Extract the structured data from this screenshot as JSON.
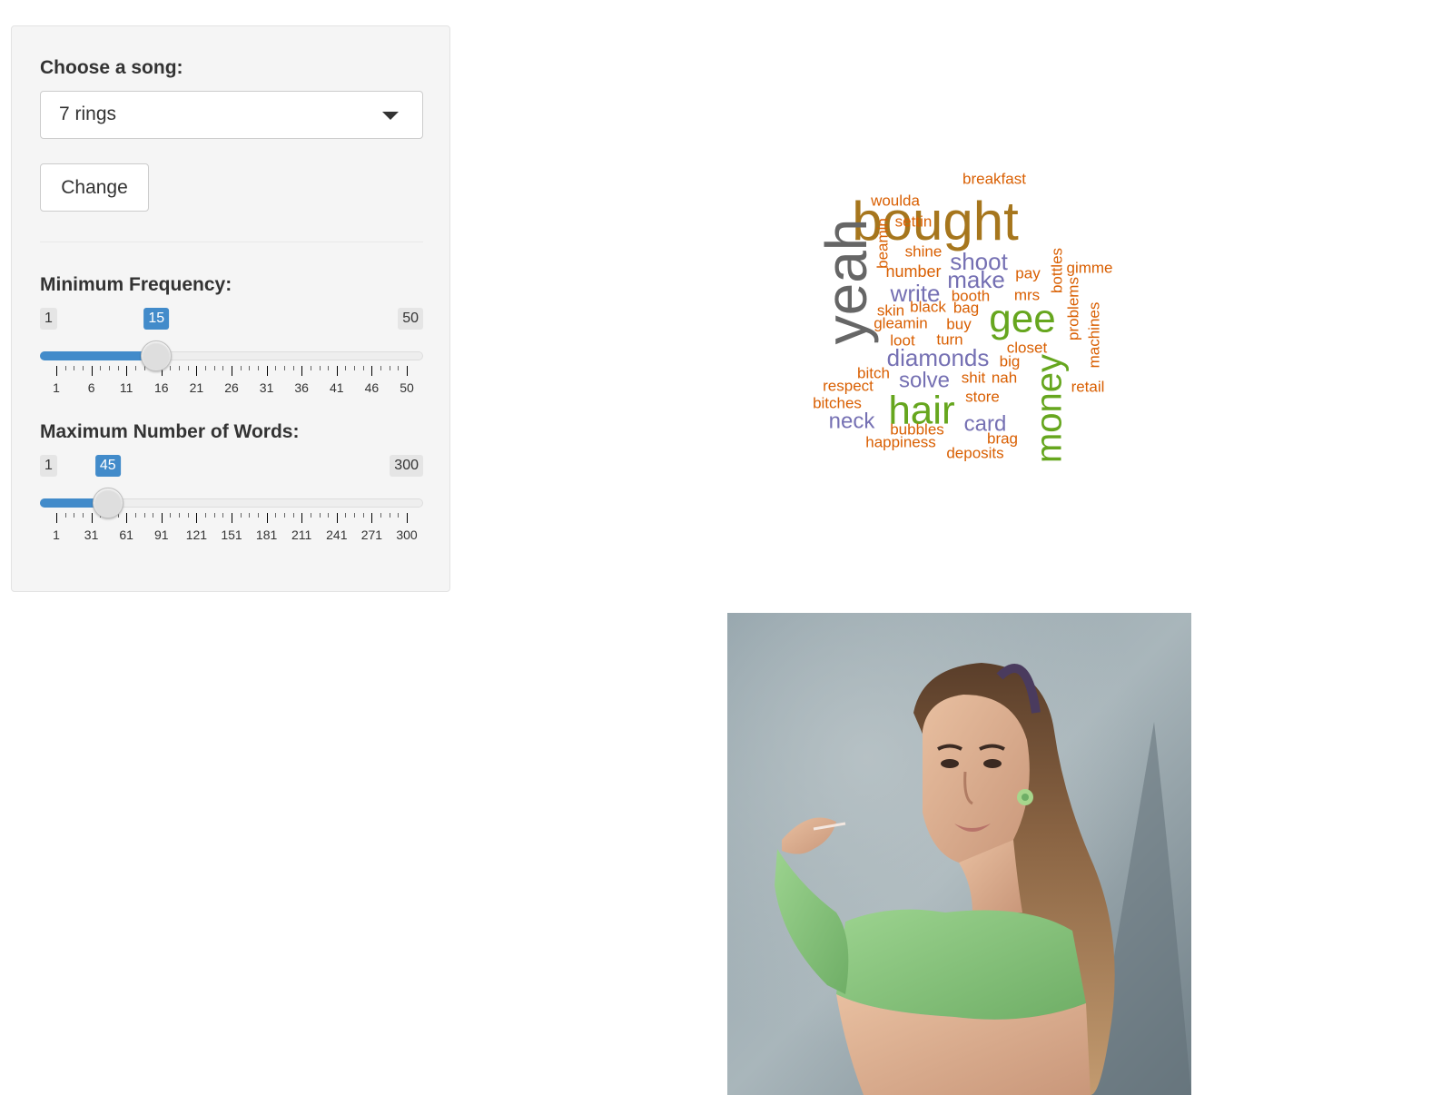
{
  "sidebar": {
    "song_label": "Choose a song:",
    "song_selected": "7 rings",
    "change_button": "Change",
    "min_freq": {
      "label": "Minimum Frequency:",
      "min": 1,
      "max": 50,
      "value": 15,
      "min_text": "1",
      "max_text": "50",
      "value_text": "15",
      "ticks": [
        "1",
        "6",
        "11",
        "16",
        "21",
        "26",
        "31",
        "36",
        "41",
        "46",
        "50"
      ]
    },
    "max_words": {
      "label": "Maximum Number of Words:",
      "min": 1,
      "max": 300,
      "value": 45,
      "min_text": "1",
      "max_text": "300",
      "value_text": "45",
      "ticks": [
        "1",
        "31",
        "61",
        "91",
        "121",
        "151",
        "181",
        "211",
        "241",
        "271",
        "300"
      ]
    }
  },
  "colors": {
    "accent": "#428bca",
    "word_orange": "#d95f02",
    "word_purple": "#7570b3",
    "word_green": "#66a61e",
    "word_gold": "#a6761d",
    "word_gray": "#666666"
  },
  "wordcloud": {
    "words": [
      {
        "text": "bought",
        "color": "#a6761d"
      },
      {
        "text": "yeah",
        "color": "#666666"
      },
      {
        "text": "money",
        "color": "#66a61e"
      },
      {
        "text": "gee",
        "color": "#66a61e"
      },
      {
        "text": "hair",
        "color": "#66a61e"
      },
      {
        "text": "shoot",
        "color": "#7570b3"
      },
      {
        "text": "make",
        "color": "#7570b3"
      },
      {
        "text": "write",
        "color": "#7570b3"
      },
      {
        "text": "diamonds",
        "color": "#7570b3"
      },
      {
        "text": "solve",
        "color": "#7570b3"
      },
      {
        "text": "neck",
        "color": "#7570b3"
      },
      {
        "text": "card",
        "color": "#7570b3"
      },
      {
        "text": "breakfast",
        "color": "#d95f02"
      },
      {
        "text": "woulda",
        "color": "#d95f02"
      },
      {
        "text": "settin",
        "color": "#d95f02"
      },
      {
        "text": "beamin",
        "color": "#d95f02"
      },
      {
        "text": "shine",
        "color": "#d95f02"
      },
      {
        "text": "number",
        "color": "#d95f02"
      },
      {
        "text": "pay",
        "color": "#d95f02"
      },
      {
        "text": "bottles",
        "color": "#d95f02"
      },
      {
        "text": "gimme",
        "color": "#d95f02"
      },
      {
        "text": "booth",
        "color": "#d95f02"
      },
      {
        "text": "mrs",
        "color": "#d95f02"
      },
      {
        "text": "problems",
        "color": "#d95f02"
      },
      {
        "text": "skin",
        "color": "#d95f02"
      },
      {
        "text": "black",
        "color": "#d95f02"
      },
      {
        "text": "bag",
        "color": "#d95f02"
      },
      {
        "text": "gleamin",
        "color": "#d95f02"
      },
      {
        "text": "buy",
        "color": "#d95f02"
      },
      {
        "text": "machines",
        "color": "#d95f02"
      },
      {
        "text": "loot",
        "color": "#d95f02"
      },
      {
        "text": "turn",
        "color": "#d95f02"
      },
      {
        "text": "closet",
        "color": "#d95f02"
      },
      {
        "text": "big",
        "color": "#d95f02"
      },
      {
        "text": "bitch",
        "color": "#d95f02"
      },
      {
        "text": "respect",
        "color": "#d95f02"
      },
      {
        "text": "shit",
        "color": "#d95f02"
      },
      {
        "text": "nah",
        "color": "#d95f02"
      },
      {
        "text": "retail",
        "color": "#d95f02"
      },
      {
        "text": "bitches",
        "color": "#d95f02"
      },
      {
        "text": "store",
        "color": "#d95f02"
      },
      {
        "text": "bubbles",
        "color": "#d95f02"
      },
      {
        "text": "brag",
        "color": "#d95f02"
      },
      {
        "text": "happiness",
        "color": "#d95f02"
      },
      {
        "text": "deposits",
        "color": "#d95f02"
      }
    ]
  },
  "image": {
    "icon": "artist-portrait"
  }
}
